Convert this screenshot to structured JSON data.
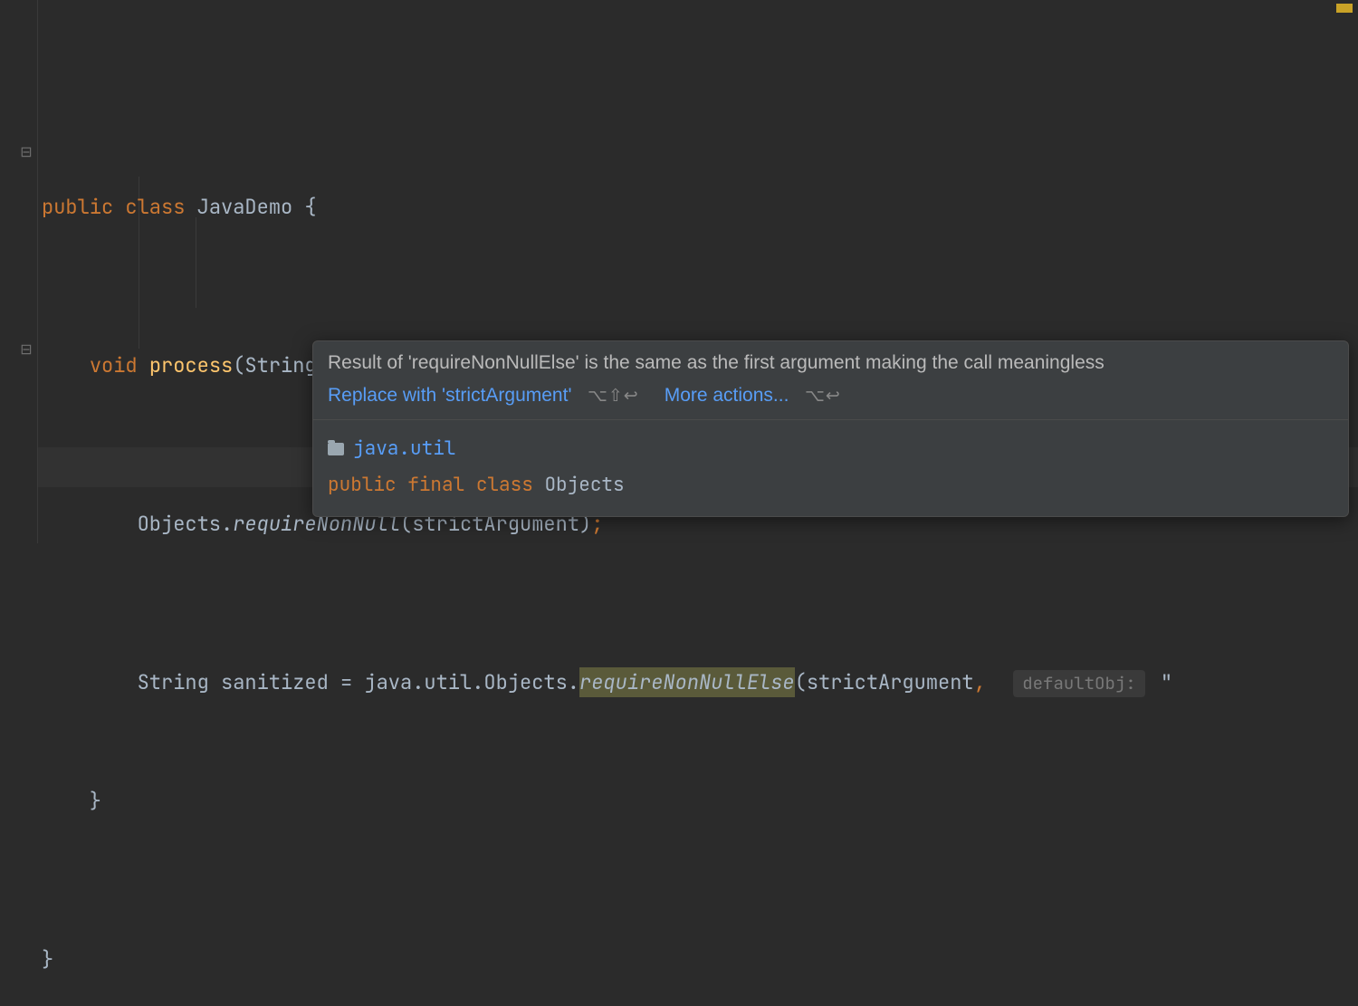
{
  "code": {
    "line1": {
      "public": "public",
      "class": "class",
      "name": "JavaDemo",
      "brace": " {"
    },
    "line2": {
      "void": "void",
      "method": "process",
      "params": "(String strictArgument) {"
    },
    "line3": {
      "obj": "Objects.",
      "method": "requireNonNull",
      "args": "(strictArgument)",
      "semi": ";"
    },
    "line4": {
      "prefix": "String sanitized = java.util.Objects.",
      "highlighted": "requireNonNullElse",
      "mid": "(strictArgument",
      "comma": ",",
      "hint": "defaultObj:",
      "tail": " \""
    },
    "line5": "    }",
    "line6": "}"
  },
  "popup": {
    "message": "Result of 'requireNonNullElse' is the same as the first argument making the call meaningless",
    "action1": "Replace with 'strictArgument'",
    "shortcut1": "⌥⇧↩",
    "action2": "More actions...",
    "shortcut2": "⌥↩",
    "doc": {
      "package": "java.util",
      "public": "public",
      "final": "final",
      "class": "class",
      "name": "Objects"
    }
  }
}
